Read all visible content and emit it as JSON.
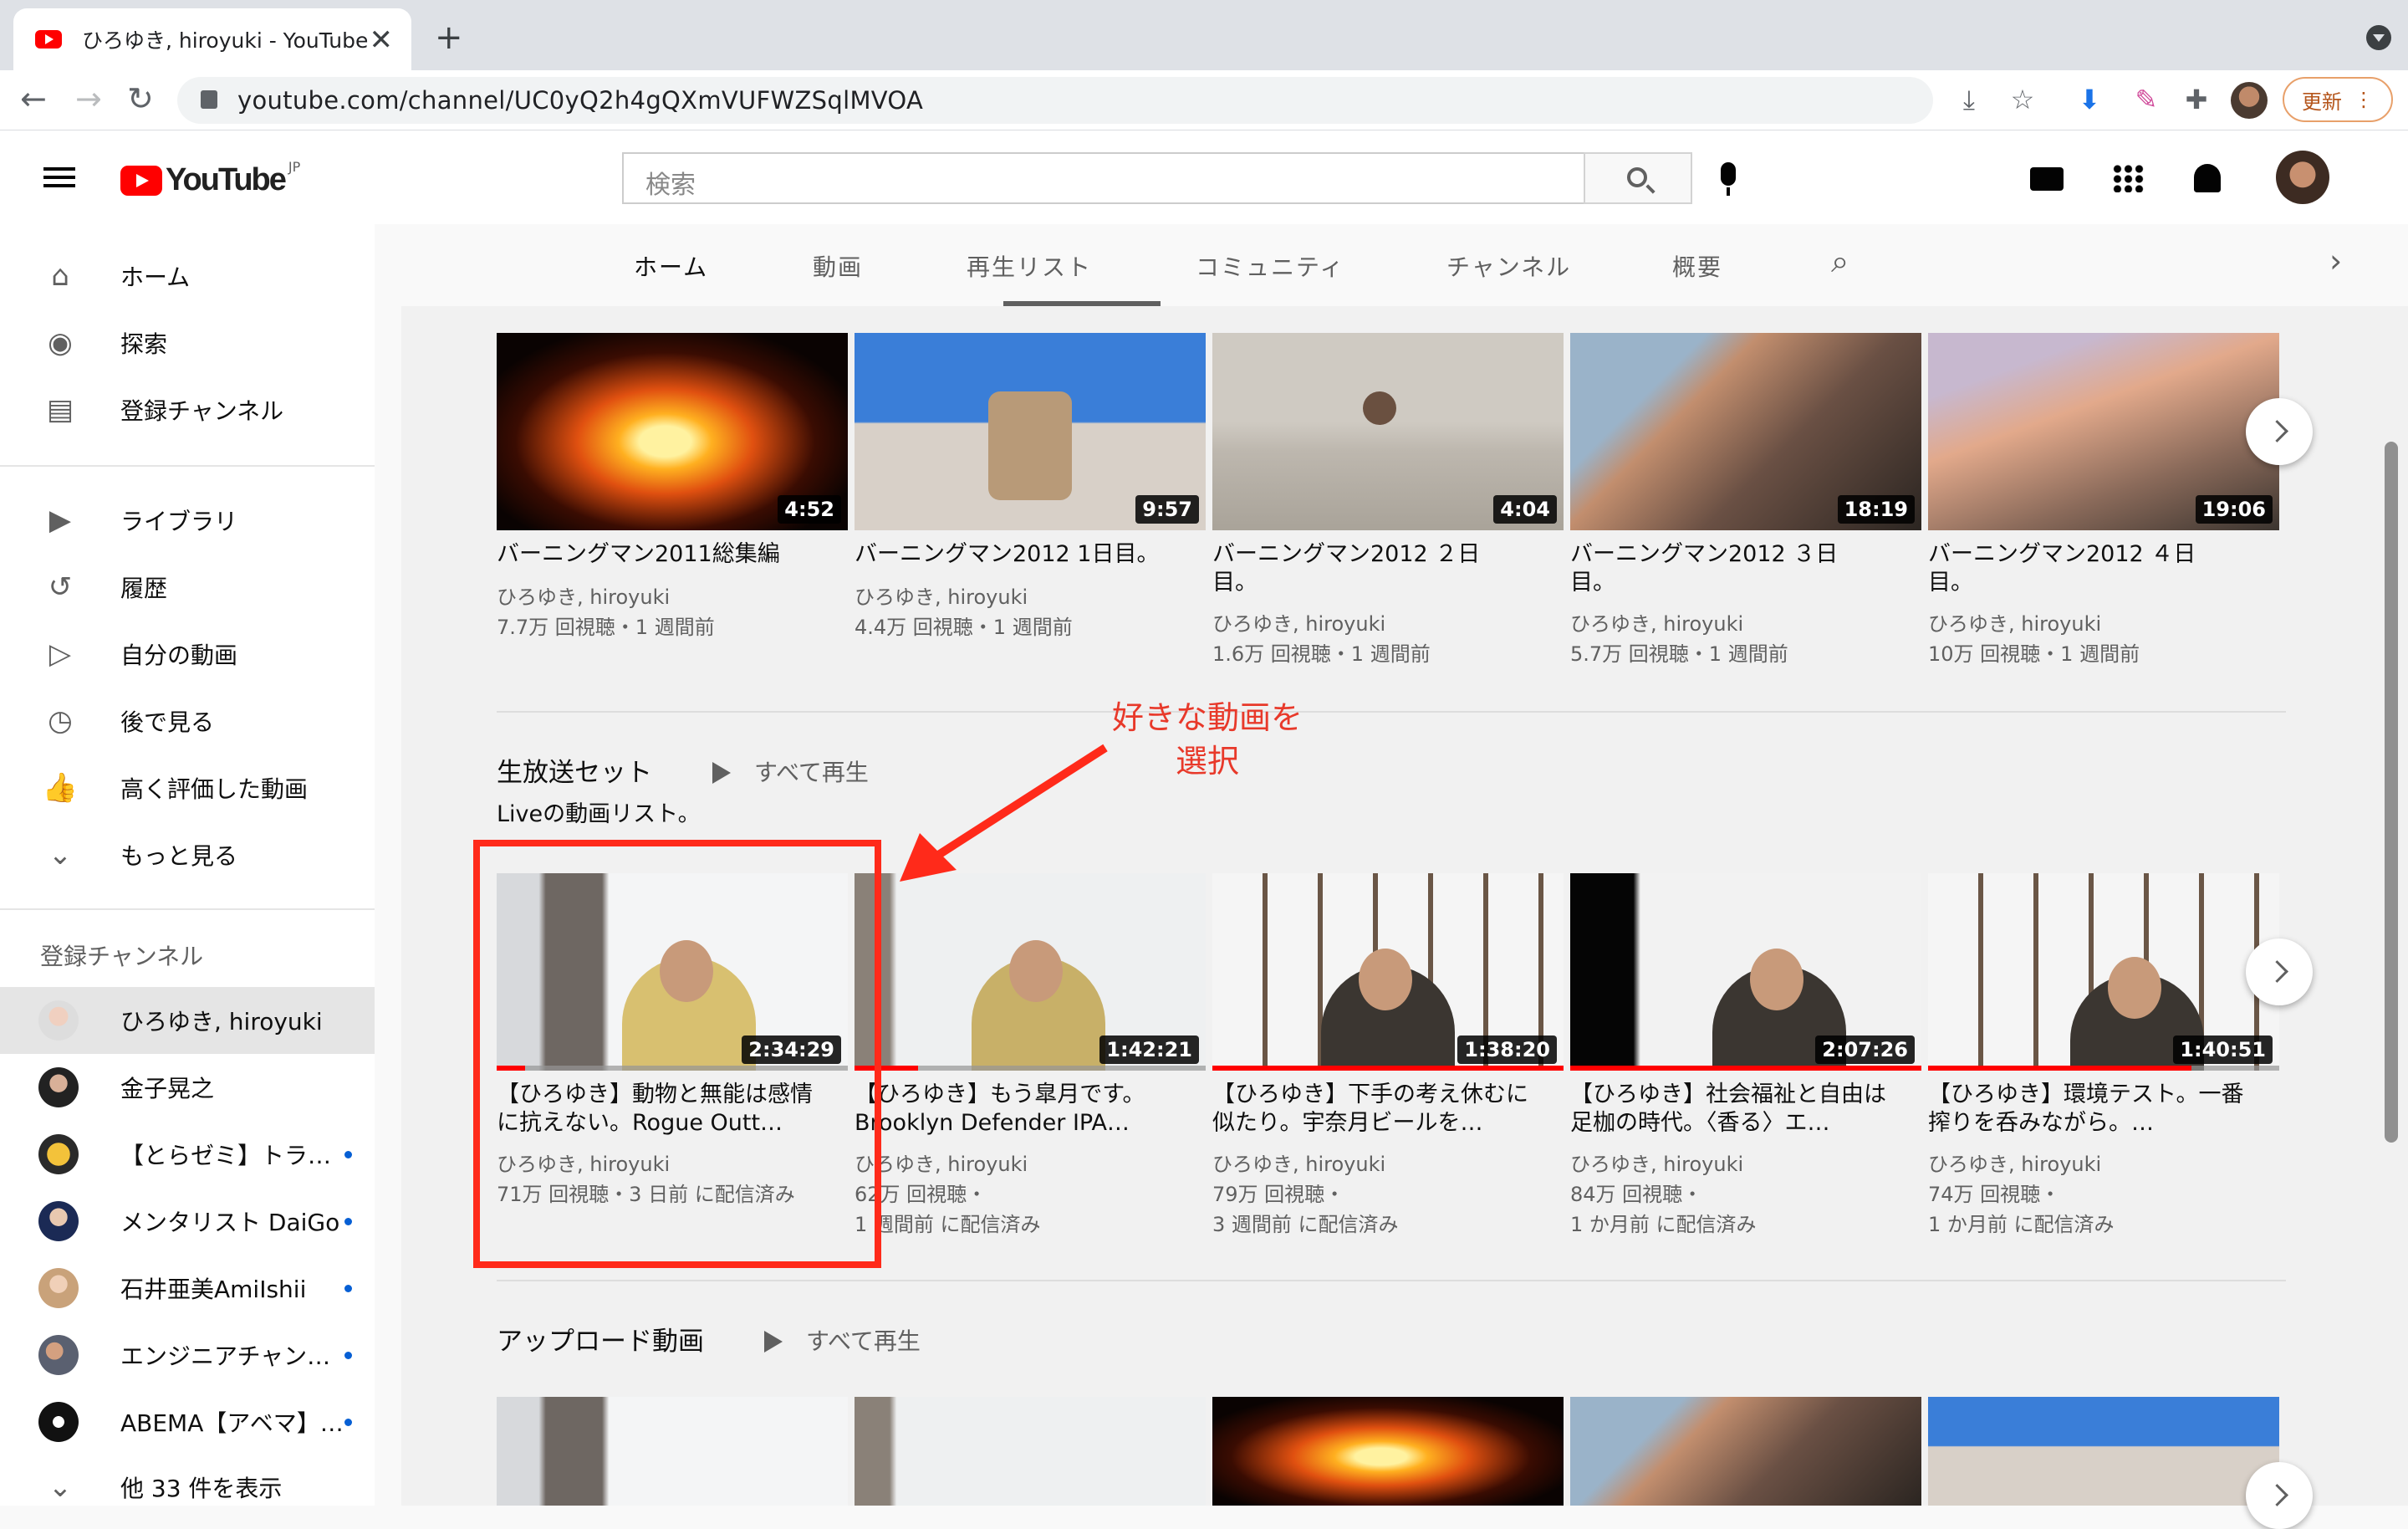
{
  "browser": {
    "tab_title": "ひろゆき, hiroyuki - YouTube",
    "url": "youtube.com/channel/UC0yQ2h4gQXmVUFWZSqlMVOA",
    "update_label": "更新"
  },
  "header": {
    "logo_text": "YouTube",
    "logo_region": "JP",
    "search_placeholder": "検索"
  },
  "sidebar": {
    "main": [
      {
        "label": "ホーム",
        "icon": "home-icon"
      },
      {
        "label": "探索",
        "icon": "explore-icon"
      },
      {
        "label": "登録チャンネル",
        "icon": "subscriptions-icon"
      }
    ],
    "library": [
      {
        "label": "ライブラリ",
        "icon": "library-icon"
      },
      {
        "label": "履歴",
        "icon": "history-icon"
      },
      {
        "label": "自分の動画",
        "icon": "your-videos-icon"
      },
      {
        "label": "後で見る",
        "icon": "watch-later-icon"
      },
      {
        "label": "高く評価した動画",
        "icon": "liked-icon"
      },
      {
        "label": "もっと見る",
        "icon": "chevron-down-icon"
      }
    ],
    "subs_heading": "登録チャンネル",
    "subscriptions": [
      {
        "label": "ひろゆき, hiroyuki",
        "active": true,
        "dot": false
      },
      {
        "label": "金子晃之",
        "active": false,
        "dot": false
      },
      {
        "label": "【とらゼミ】トラ…",
        "active": false,
        "dot": true
      },
      {
        "label": "メンタリスト DaiGo",
        "active": false,
        "dot": true
      },
      {
        "label": "石井亜美AmiIshii",
        "active": false,
        "dot": true
      },
      {
        "label": "エンジニアチャン…",
        "active": false,
        "dot": true
      },
      {
        "label": "ABEMA【アベマ】…",
        "active": false,
        "dot": true
      }
    ],
    "show_more": "他 33 件を表示"
  },
  "channel_tabs": [
    "ホーム",
    "動画",
    "再生リスト",
    "コミュニティ",
    "チャンネル",
    "概要"
  ],
  "shelf1": {
    "videos": [
      {
        "title": "バーニングマン2011総集編",
        "channel": "ひろゆき, hiroyuki",
        "meta1": "7.7万 回視聴・1 週間前",
        "meta2": "",
        "duration": "4:52"
      },
      {
        "title": "バーニングマン2012 1日目。",
        "channel": "ひろゆき, hiroyuki",
        "meta1": "4.4万 回視聴・1 週間前",
        "meta2": "",
        "duration": "9:57"
      },
      {
        "title": "バーニングマン2012 ２日目。",
        "channel": "ひろゆき, hiroyuki",
        "meta1": "1.6万 回視聴・1 週間前",
        "meta2": "",
        "duration": "4:04"
      },
      {
        "title": "バーニングマン2012 ３日目。",
        "channel": "ひろゆき, hiroyuki",
        "meta1": "5.7万 回視聴・1 週間前",
        "meta2": "",
        "duration": "18:19"
      },
      {
        "title": "バーニングマン2012 ４日目。",
        "channel": "ひろゆき, hiroyuki",
        "meta1": "10万 回視聴・1 週間前",
        "meta2": "",
        "duration": "19:06"
      }
    ]
  },
  "shelf2": {
    "title": "生放送セット",
    "play_all": "すべて再生",
    "description": "Liveの動画リスト。",
    "videos": [
      {
        "title": "【ひろゆき】動物と無能は感情に抗えない。Rogue Outt…",
        "channel": "ひろゆき, hiroyuki",
        "meta1": "71万 回視聴・3 日前 に配信済み",
        "meta2": "",
        "duration": "2:34:29",
        "progress": 0.08
      },
      {
        "title": "【ひろゆき】もう皐月です。Brooklyn Defender IPA…",
        "channel": "ひろゆき, hiroyuki",
        "meta1": "62万 回視聴・",
        "meta2": "1 週間前 に配信済み",
        "duration": "1:42:21",
        "progress": 0.18
      },
      {
        "title": "【ひろゆき】下手の考え休むに似たり。宇奈月ビールを…",
        "channel": "ひろゆき, hiroyuki",
        "meta1": "79万 回視聴・",
        "meta2": "3 週間前 に配信済み",
        "duration": "1:38:20",
        "progress": 1.0
      },
      {
        "title": "【ひろゆき】社会福祉と自由は足枷の時代。〈香る〉エ…",
        "channel": "ひろゆき, hiroyuki",
        "meta1": "84万 回視聴・",
        "meta2": "1 か月前 に配信済み",
        "duration": "2:07:26",
        "progress": 1.0
      },
      {
        "title": "【ひろゆき】環境テスト。一番搾りを呑みながら。…",
        "channel": "ひろゆき, hiroyuki",
        "meta1": "74万 回視聴・",
        "meta2": "1 か月前 に配信済み",
        "duration": "1:40:51",
        "progress": 0.75
      }
    ]
  },
  "shelf3": {
    "title": "アップロード動画",
    "play_all": "すべて再生"
  },
  "annotation": {
    "line1": "好きな動画を",
    "line2": "選択"
  },
  "colors": {
    "annotation": "#e8392a",
    "highlight_box": "#ff2a1a",
    "youtube_red": "#ff0000"
  }
}
